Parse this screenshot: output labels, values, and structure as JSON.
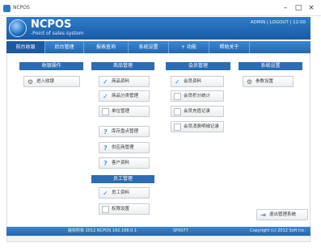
{
  "window": {
    "title": "NCPOS"
  },
  "header": {
    "brand": "NCPOS",
    "tagline": "-Point of sales system",
    "user_info": "ADMIN | LOGOUT | 12:00"
  },
  "nav": {
    "tabs": [
      "前台收银",
      "后台管理",
      "报表查询",
      "系统设置",
      "+ 功能",
      "帮助关于"
    ]
  },
  "columns": [
    {
      "title": "收银操作",
      "items": [
        {
          "label": "进入收银",
          "icon": "gear"
        }
      ]
    },
    {
      "title": "商品管理",
      "items": [
        {
          "label": "商品资料",
          "icon": "check"
        },
        {
          "label": "商品分类管理",
          "icon": "check"
        },
        {
          "label": "单位管理",
          "icon": "box"
        },
        {
          "label": "库存盘点管理",
          "icon": "question"
        },
        {
          "label": "供应商管理",
          "icon": "question"
        },
        {
          "label": "客户资料",
          "icon": "question"
        }
      ]
    },
    {
      "title": "会员管理",
      "items": [
        {
          "label": "会员资料",
          "icon": "check"
        },
        {
          "label": "会员积分统计",
          "icon": "box"
        },
        {
          "label": "会员充值记录",
          "icon": "box"
        },
        {
          "label": "会员消费明细记录",
          "icon": "box"
        }
      ]
    },
    {
      "title": "系统设置",
      "items": [
        {
          "label": "参数设置",
          "icon": "gear"
        }
      ]
    }
  ],
  "sub_section": {
    "title": "员工管理",
    "items": [
      {
        "label": "员工资料",
        "icon": "check"
      },
      {
        "label": "权限设置",
        "icon": "box"
      }
    ]
  },
  "exit_button": {
    "label": "退出管理系统"
  },
  "footer": {
    "left": "版权所有 2012 NCPOS 192.168.0.1",
    "mid": "SP0077",
    "right": "Copyright (c) 2012 Soft Inc."
  }
}
